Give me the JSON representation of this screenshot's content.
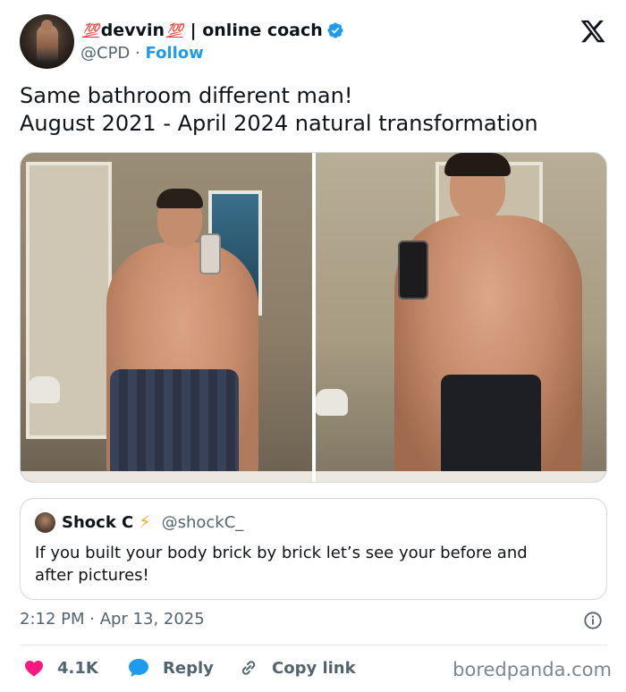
{
  "author": {
    "emoji_left": "💯",
    "name": "devvin",
    "emoji_right": "💯",
    "name_suffix": "| online coach",
    "handle": "@CPD",
    "separator": "·",
    "follow_label": "Follow"
  },
  "tweet": {
    "lines": [
      "Same bathroom different man!",
      "August 2021 - April 2024 natural transformation"
    ]
  },
  "quoted": {
    "name": "Shock C",
    "emoji": "⚡",
    "handle": "@shockC_",
    "lines": [
      "If you built your body brick by brick let’s see your before and",
      "after pictures!"
    ]
  },
  "meta": {
    "timestamp": "2:12 PM · Apr 13, 2025"
  },
  "actions": {
    "likes": "4.1K",
    "reply_label": "Reply",
    "copy_label": "Copy link"
  },
  "watermark": "boredpanda.com",
  "colors": {
    "accent": "#1d9bf0",
    "like": "#f91880",
    "muted": "#536471",
    "emoji_red": "#e0245e"
  },
  "icons": [
    "verified-badge-icon",
    "x-logo-icon",
    "info-icon",
    "heart-icon",
    "reply-bubble-icon",
    "link-icon"
  ]
}
